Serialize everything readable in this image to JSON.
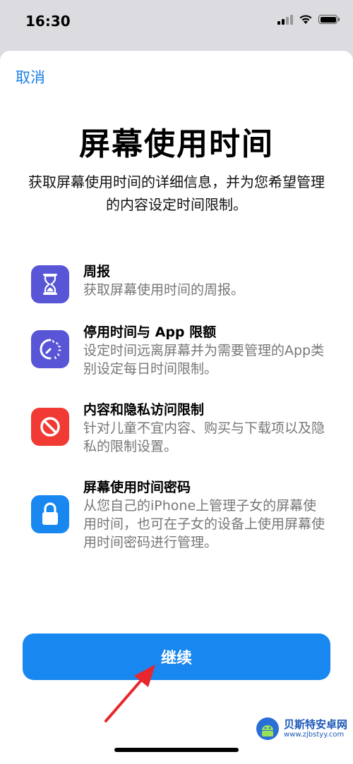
{
  "status_bar": {
    "time": "16:30"
  },
  "header": {
    "cancel_label": "取消"
  },
  "page": {
    "title": "屏幕使用时间",
    "subtitle": "获取屏幕使用时间的详细信息，并为您希望管理的内容设定时间限制。"
  },
  "features": [
    {
      "icon": "hourglass-icon",
      "icon_color": "#5856d6",
      "title": "周报",
      "desc": "获取屏幕使用时间的周报。"
    },
    {
      "icon": "downtime-icon",
      "icon_color": "#5856d6",
      "title": "停用时间与 App 限额",
      "desc": "设定时间远离屏幕并为需要管理的App类别设定每日时间限制。"
    },
    {
      "icon": "restriction-icon",
      "icon_color": "#f03a33",
      "title": "内容和隐私访问限制",
      "desc": "针对儿童不宜内容、购买与下载项以及隐私的限制设置。"
    },
    {
      "icon": "lock-icon",
      "icon_color": "#1987f0",
      "title": "屏幕使用时间密码",
      "desc": "从您自己的iPhone上管理子女的屏幕使用时间，也可在子女的设备上使用屏幕使用时间密码进行管理。"
    }
  ],
  "footer": {
    "continue_label": "继续"
  },
  "watermark": {
    "name": "贝斯特安卓网",
    "url": "www.zjbstyy.com"
  },
  "colors": {
    "accent": "#1987f0",
    "link": "#1a7fe6",
    "annotation": "#e8262b"
  }
}
